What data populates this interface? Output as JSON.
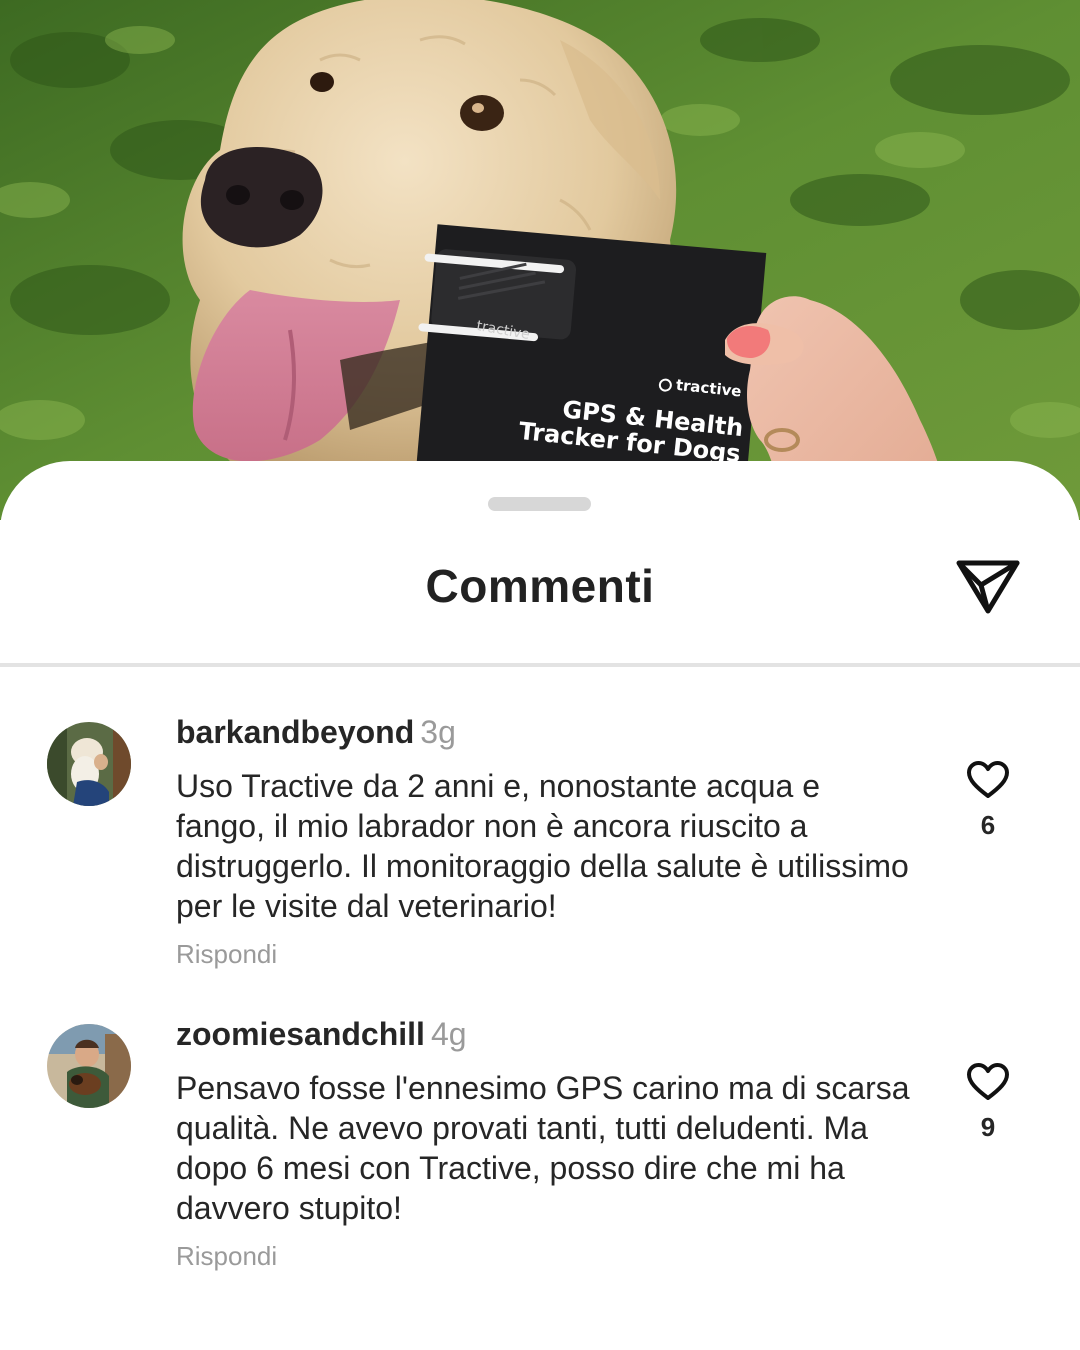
{
  "photo": {
    "box_logo": "tractive",
    "box_title_line1": "GPS & Health",
    "box_title_line2": "Tracker for Dogs",
    "device_logo": "tractive"
  },
  "sheet": {
    "title": "Commenti",
    "share_icon": "paper-plane-icon"
  },
  "comments": [
    {
      "username": "barkandbeyond",
      "time": "3g",
      "text": "Uso Tractive da 2 anni e, nonostante acqua e fango, il mio labrador non è ancora riuscito a distruggerlo. Il monitoraggio della salute è utilissimo per le visite dal veterinario!",
      "reply_label": "Rispondi",
      "likes": "6",
      "like_icon": "heart-icon"
    },
    {
      "username": "zoomiesandchill",
      "time": "4g",
      "text": "Pensavo fosse l'ennesimo GPS carino ma di scarsa qualità. Ne avevo provati tanti, tutti deludenti. Ma dopo 6 mesi con Tractive, posso dire che mi ha davvero stupito!",
      "reply_label": "Rispondi",
      "likes": "9",
      "like_icon": "heart-icon"
    }
  ],
  "colors": {
    "text": "#262626",
    "muted": "#9a9a9a",
    "divider": "#e3e3e3",
    "handle": "#d7d7d7"
  }
}
